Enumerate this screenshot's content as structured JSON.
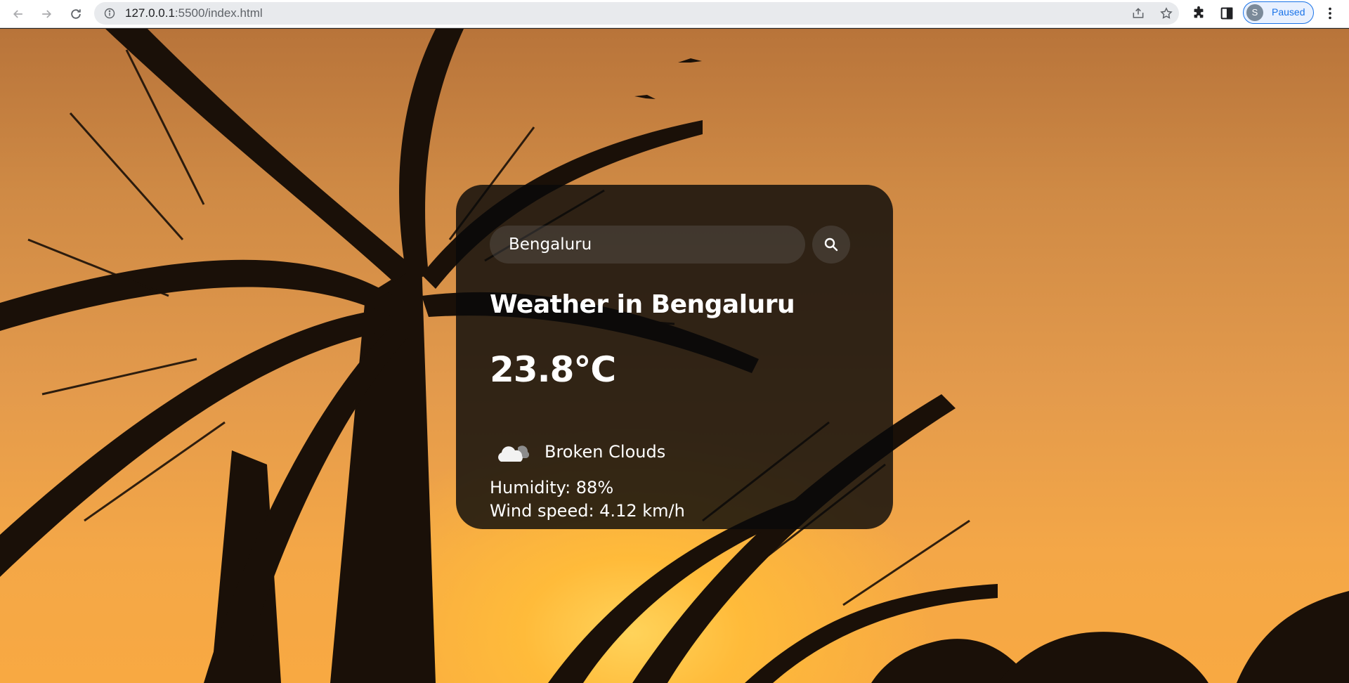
{
  "browser": {
    "url_host": "127.0.0.1",
    "url_path": ":5500/index.html",
    "profile_initial": "S",
    "profile_status": "Paused",
    "accent_color": "#1a73e8"
  },
  "weather": {
    "search": {
      "value": "Bengaluru",
      "placeholder": "Search"
    },
    "title": "Weather in Bengaluru",
    "temperature": "23.8°C",
    "condition": "Broken Clouds",
    "condition_icon": "cloud-icon",
    "humidity": "Humidity: 88%",
    "wind": "Wind speed: 4.12 km/h"
  },
  "colors": {
    "card_background": "rgba(10,10,10,0.82)",
    "text": "#ffffff",
    "sky_top": "#b8743a",
    "sky_bottom": "#f8a942"
  }
}
